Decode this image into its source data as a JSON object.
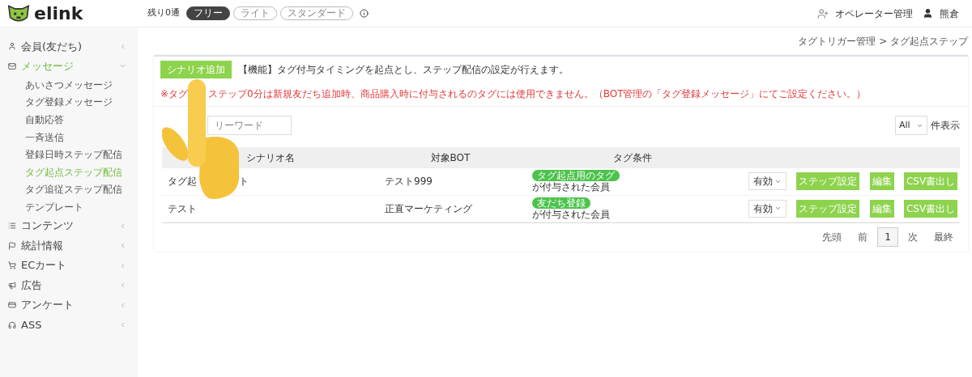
{
  "header": {
    "logo": "elink",
    "remaining": "残り0通",
    "plans": [
      {
        "label": "フリー",
        "selected": true
      },
      {
        "label": "ライト",
        "selected": false
      },
      {
        "label": "スタンダード",
        "selected": false
      }
    ],
    "operator": "オペレーター管理",
    "user": "熊倉"
  },
  "sidebar": {
    "items": [
      {
        "label": "会員(友だち)",
        "expanded": false
      },
      {
        "label": "メッセージ",
        "expanded": true,
        "children": [
          {
            "label": "あいさつメッセージ",
            "selected": false
          },
          {
            "label": "タグ登録メッセージ",
            "selected": false
          },
          {
            "label": "自動応答",
            "selected": false
          },
          {
            "label": "一斉送信",
            "selected": false
          },
          {
            "label": "登録日時ステップ配信",
            "selected": false
          },
          {
            "label": "タグ起点ステップ配信",
            "selected": true
          },
          {
            "label": "タグ追従ステップ配信",
            "selected": false
          },
          {
            "label": "テンプレート",
            "selected": false
          }
        ]
      },
      {
        "label": "コンテンツ",
        "expanded": false
      },
      {
        "label": "統計情報",
        "expanded": false
      },
      {
        "label": "ECカート",
        "expanded": false
      },
      {
        "label": "広告",
        "expanded": false
      },
      {
        "label": "アンケート",
        "expanded": false
      },
      {
        "label": "ASS",
        "expanded": false
      }
    ]
  },
  "breadcrumb": "タグトリガー管理 > タグ起点ステップ",
  "add_button": "シナリオ追加",
  "description": "【機能】タグ付与タイミングを起点とし、ステップ配信の設定が行えます。",
  "warning": [
    "※タグ",
    "ステップ0分は新規友だち追加時、商品購入時に付与されるのタグには使用できません。（BOT管理の「タグ登録メッセージ」にてご設定ください。）"
  ],
  "search": {
    "placeholder": "リーワード"
  },
  "page_size": {
    "value": "All",
    "suffix": "件表示"
  },
  "table": {
    "columns": [
      "シナリオ名",
      "対象BOT",
      "タグ条件"
    ],
    "rows": [
      {
        "name": [
          "タグ起",
          "ト"
        ],
        "bot": "テスト999",
        "tag": "タグ起点用のタグ",
        "tag_suffix": "が付与された会員",
        "status": "有効",
        "actions": [
          "ステップ設定",
          "編集",
          "CSV書出し"
        ]
      },
      {
        "name": [
          "テスト"
        ],
        "bot": "正直マーケティング",
        "tag": "友だち登録",
        "tag_suffix": "が付与された会員",
        "status": "有効",
        "actions": [
          "ステップ設定",
          "編集",
          "CSV書出し"
        ]
      }
    ]
  },
  "pagination": [
    {
      "label": "先頭",
      "selected": false
    },
    {
      "label": "前",
      "selected": false
    },
    {
      "label": "1",
      "selected": true
    },
    {
      "label": "次",
      "selected": false
    },
    {
      "label": "最終",
      "selected": false
    }
  ]
}
